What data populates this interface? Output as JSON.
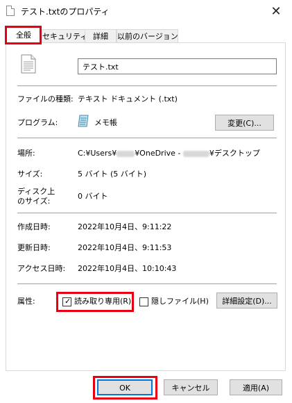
{
  "window": {
    "title": "テスト.txtのプロパティ",
    "close_glyph": "✕"
  },
  "tabs": [
    {
      "label": "全般",
      "active": true
    },
    {
      "label": "セキュリティ",
      "active": false
    },
    {
      "label": "詳細",
      "active": false
    },
    {
      "label": "以前のバージョン",
      "active": false
    }
  ],
  "general": {
    "file_name": "テスト.txt",
    "file_type_label": "ファイルの種類:",
    "file_type_value": "テキスト ドキュメント (.txt)",
    "program_label": "プログラム:",
    "program_value": "メモ帳",
    "change_button": "変更(C)...",
    "location_label": "場所:",
    "location_part1": "C:¥Users¥",
    "location_part2": "¥OneDrive -",
    "location_part3": "¥デスクトップ",
    "size_label": "サイズ:",
    "size_value": "5 バイト (5 バイト)",
    "disk_size_label_line1": "ディスク上",
    "disk_size_label_line2": "のサイズ:",
    "disk_size_value": "0 バイト",
    "created_label": "作成日時:",
    "created_value": "2022年10月4日、9:11:22",
    "modified_label": "更新日時:",
    "modified_value": "2022年10月4日、9:11:53",
    "accessed_label": "アクセス日時:",
    "accessed_value": "2022年10月4日、10:10:43",
    "attributes_label": "属性:",
    "readonly_label": "読み取り専用(R)",
    "readonly_checked": true,
    "hidden_label": "隠しファイル(H)",
    "hidden_checked": false,
    "advanced_button": "詳細設定(D)..."
  },
  "footer": {
    "ok": "OK",
    "cancel": "キャンセル",
    "apply": "適用(A)"
  },
  "colors": {
    "highlight": "#e60012",
    "ok_border": "#0078d7"
  }
}
